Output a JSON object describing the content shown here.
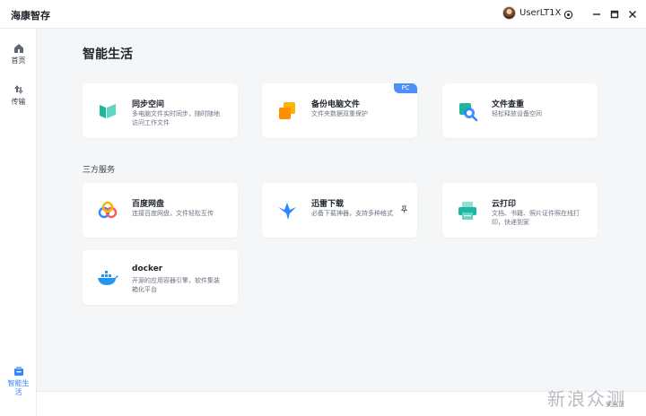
{
  "app": {
    "title": "海康智存"
  },
  "user": {
    "name": "UserLT1X"
  },
  "window": {
    "settings_icon": "settings-icon",
    "minimize_icon": "minimize-icon",
    "maximize_icon": "maximize-icon",
    "close_icon": "close-icon"
  },
  "sidebar": {
    "items": [
      {
        "label": "首页",
        "icon": "home-icon",
        "active": false
      },
      {
        "label": "传输",
        "icon": "transfer-icon",
        "active": false
      },
      {
        "label": "智能生活",
        "icon": "smart-life-icon",
        "active": true
      }
    ]
  },
  "main": {
    "page_title": "智能生活",
    "section_title": "三方服务",
    "cards": [
      {
        "title": "同步空间",
        "desc": "多电脑文件实时同步，随时随地访问工作文件",
        "icon": "sync-space-icon"
      },
      {
        "title": "备份电脑文件",
        "desc": "文件夹数据双重保护",
        "icon": "backup-icon",
        "badge": "PC"
      },
      {
        "title": "文件查重",
        "desc": "轻松释放设备空间",
        "icon": "duplicate-search-icon"
      },
      {
        "title": "百度网盘",
        "desc": "连接百度网盘，文件轻松互传",
        "icon": "baidu-netdisk-icon"
      },
      {
        "title": "迅雷下载",
        "desc": "必备下载神器，支持多种格式",
        "icon": "thunder-download-icon"
      },
      {
        "title": "云打印",
        "desc": "文档、书籍、照片证件照在线打印，快递到家",
        "icon": "cloud-print-icon"
      },
      {
        "title": "docker",
        "desc": "开源的应用容器引擎，软件集装箱化平台",
        "icon": "docker-icon"
      }
    ]
  },
  "watermark": {
    "text": "新浪众测",
    "sub": "安全货"
  },
  "colors": {
    "accent": "#2f86ff",
    "badge": "#4d8ef7",
    "teal": "#1fb6a0"
  }
}
